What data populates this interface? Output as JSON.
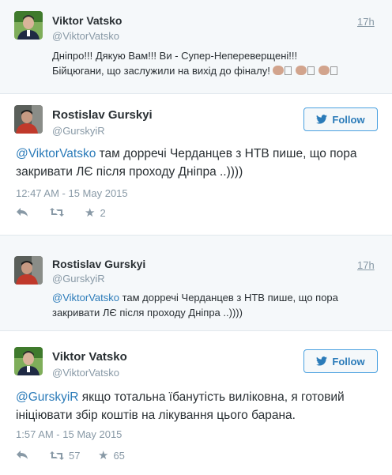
{
  "colors": {
    "link": "#2b7bb9",
    "muted": "#8899a6",
    "text": "#292f33",
    "divider": "#e1e8ed"
  },
  "tweets": [
    {
      "name": "Viktor Vatsko",
      "handle": "@ViktorVatsko",
      "time": "17h",
      "text_line1": "Дніпро!!! Дякую Вам!!! Ви - Супер-Непереверщені!!!",
      "text_line2": "Бійцюгани, що заслужили на вихід до фіналу!"
    },
    {
      "name": "Rostislav Gurskyi",
      "handle": "@GurskyiR",
      "follow_label": "Follow",
      "mention": "@ViktorVatsko",
      "text_rest": " там дорречі Черданцев з НТВ пише, що пора",
      "text_line2": "закривати ЛЄ після проходу Дніпра ..))))",
      "timestamp": "12:47 AM - 15 May 2015",
      "favorites": "2"
    },
    {
      "name": "Rostislav Gurskyi",
      "handle": "@GurskyiR",
      "time": "17h",
      "mention": "@ViktorVatsko",
      "text_rest": " там дорречі Черданцев з НТВ пише, що пора",
      "text_line2": "закривати ЛЄ після проходу Дніпра ..))))"
    },
    {
      "name": "Viktor Vatsko",
      "handle": "@ViktorVatsko",
      "follow_label": "Follow",
      "mention": "@GurskyiR",
      "text_rest": " якщо тотальна їбанутість виліковна, я готовий",
      "text_line2": "ініціювати збір коштів на лікування цього барана.",
      "timestamp": "1:57 AM - 15 May 2015",
      "retweets": "57",
      "favorites": "65"
    }
  ]
}
